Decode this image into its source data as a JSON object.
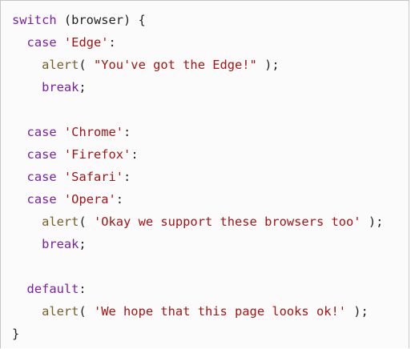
{
  "lines": [
    {
      "tokens": [
        {
          "t": "kw",
          "v": "switch"
        },
        {
          "t": "punc",
          "v": " (browser) {"
        }
      ]
    },
    {
      "tokens": [
        {
          "t": "punc",
          "v": "  "
        },
        {
          "t": "kw",
          "v": "case"
        },
        {
          "t": "punc",
          "v": " "
        },
        {
          "t": "str",
          "v": "'Edge'"
        },
        {
          "t": "punc",
          "v": ":"
        }
      ]
    },
    {
      "tokens": [
        {
          "t": "punc",
          "v": "    "
        },
        {
          "t": "fn",
          "v": "alert"
        },
        {
          "t": "punc",
          "v": "( "
        },
        {
          "t": "str",
          "v": "\"You've got the Edge!\""
        },
        {
          "t": "punc",
          "v": " );"
        }
      ]
    },
    {
      "tokens": [
        {
          "t": "punc",
          "v": "    "
        },
        {
          "t": "kw",
          "v": "break"
        },
        {
          "t": "punc",
          "v": ";"
        }
      ]
    },
    {
      "tokens": [
        {
          "t": "punc",
          "v": ""
        }
      ]
    },
    {
      "tokens": [
        {
          "t": "punc",
          "v": "  "
        },
        {
          "t": "kw",
          "v": "case"
        },
        {
          "t": "punc",
          "v": " "
        },
        {
          "t": "str",
          "v": "'Chrome'"
        },
        {
          "t": "punc",
          "v": ":"
        }
      ]
    },
    {
      "tokens": [
        {
          "t": "punc",
          "v": "  "
        },
        {
          "t": "kw",
          "v": "case"
        },
        {
          "t": "punc",
          "v": " "
        },
        {
          "t": "str",
          "v": "'Firefox'"
        },
        {
          "t": "punc",
          "v": ":"
        }
      ]
    },
    {
      "tokens": [
        {
          "t": "punc",
          "v": "  "
        },
        {
          "t": "kw",
          "v": "case"
        },
        {
          "t": "punc",
          "v": " "
        },
        {
          "t": "str",
          "v": "'Safari'"
        },
        {
          "t": "punc",
          "v": ":"
        }
      ]
    },
    {
      "tokens": [
        {
          "t": "punc",
          "v": "  "
        },
        {
          "t": "kw",
          "v": "case"
        },
        {
          "t": "punc",
          "v": " "
        },
        {
          "t": "str",
          "v": "'Opera'"
        },
        {
          "t": "punc",
          "v": ":"
        }
      ]
    },
    {
      "tokens": [
        {
          "t": "punc",
          "v": "    "
        },
        {
          "t": "fn",
          "v": "alert"
        },
        {
          "t": "punc",
          "v": "( "
        },
        {
          "t": "str",
          "v": "'Okay we support these browsers too'"
        },
        {
          "t": "punc",
          "v": " );"
        }
      ]
    },
    {
      "tokens": [
        {
          "t": "punc",
          "v": "    "
        },
        {
          "t": "kw",
          "v": "break"
        },
        {
          "t": "punc",
          "v": ";"
        }
      ]
    },
    {
      "tokens": [
        {
          "t": "punc",
          "v": ""
        }
      ]
    },
    {
      "tokens": [
        {
          "t": "punc",
          "v": "  "
        },
        {
          "t": "kw",
          "v": "default"
        },
        {
          "t": "punc",
          "v": ":"
        }
      ]
    },
    {
      "tokens": [
        {
          "t": "punc",
          "v": "    "
        },
        {
          "t": "fn",
          "v": "alert"
        },
        {
          "t": "punc",
          "v": "( "
        },
        {
          "t": "str",
          "v": "'We hope that this page looks ok!'"
        },
        {
          "t": "punc",
          "v": " );"
        }
      ]
    },
    {
      "tokens": [
        {
          "t": "punc",
          "v": "}"
        }
      ]
    }
  ],
  "colors": {
    "keyword": "#7a1fa2",
    "function": "#795e26",
    "string": "#a31515",
    "punctuation": "#222222",
    "background": "#fbfbfb",
    "border": "#c6c6c6"
  }
}
